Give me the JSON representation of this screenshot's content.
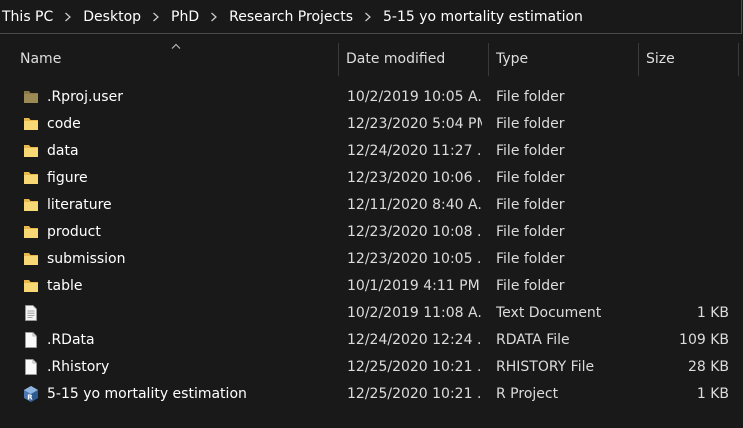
{
  "breadcrumb": [
    "This PC",
    "Desktop",
    "PhD",
    "Research Projects",
    "5-15 yo mortality estimation"
  ],
  "columns": {
    "name": "Name",
    "date": "Date modified",
    "type": "Type",
    "size": "Size"
  },
  "colors": {
    "background": "#191919",
    "folder": "#f8d775",
    "folder_hidden": "#8a7a4a",
    "separator": "#3a3a3a"
  },
  "files": [
    {
      "name": ".Rproj.user",
      "date": "10/2/2019 10:05 A...",
      "type": "File folder",
      "size": "",
      "icon": "folder-hidden-icon"
    },
    {
      "name": "code",
      "date": "12/23/2020 5:04 PM",
      "type": "File folder",
      "size": "",
      "icon": "folder-icon"
    },
    {
      "name": "data",
      "date": "12/24/2020 11:27 ...",
      "type": "File folder",
      "size": "",
      "icon": "folder-icon"
    },
    {
      "name": "figure",
      "date": "12/23/2020 10:06 ...",
      "type": "File folder",
      "size": "",
      "icon": "folder-icon"
    },
    {
      "name": "literature",
      "date": "12/11/2020 8:40 A...",
      "type": "File folder",
      "size": "",
      "icon": "folder-icon"
    },
    {
      "name": "product",
      "date": "12/23/2020 10:08 ...",
      "type": "File folder",
      "size": "",
      "icon": "folder-icon"
    },
    {
      "name": "submission",
      "date": "12/23/2020 10:05 ...",
      "type": "File folder",
      "size": "",
      "icon": "folder-icon"
    },
    {
      "name": "table",
      "date": "10/1/2019 4:11 PM",
      "type": "File folder",
      "size": "",
      "icon": "folder-icon"
    },
    {
      "name": "",
      "date": "10/2/2019 11:08 A...",
      "type": "Text Document",
      "size": "1 KB",
      "icon": "text-document-icon"
    },
    {
      "name": ".RData",
      "date": "12/24/2020 12:24 ...",
      "type": "RDATA File",
      "size": "109 KB",
      "icon": "file-icon"
    },
    {
      "name": ".Rhistory",
      "date": "12/25/2020 10:21 ...",
      "type": "RHISTORY File",
      "size": "28 KB",
      "icon": "file-icon"
    },
    {
      "name": "5-15 yo mortality estimation",
      "date": "12/25/2020 10:21 ...",
      "type": "R Project",
      "size": "1 KB",
      "icon": "r-project-icon"
    }
  ]
}
